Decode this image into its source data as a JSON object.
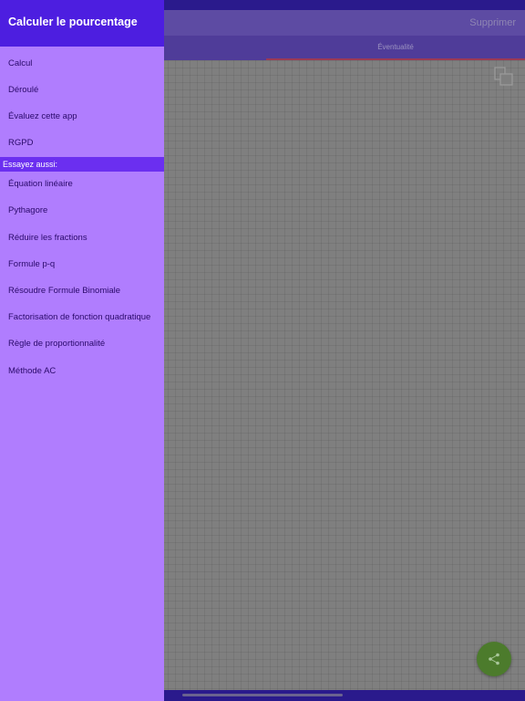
{
  "app": {
    "delete_label": "Supprimer",
    "tab_label": "Éventualité"
  },
  "drawer": {
    "title": "Calculer le pourcentage",
    "items": [
      {
        "label": "Calcul"
      },
      {
        "label": "Déroulé"
      },
      {
        "label": "Évaluez cette app"
      },
      {
        "label": "RGPD"
      }
    ],
    "section_label": "Essayez aussi:",
    "related": [
      {
        "label": "Équation linéaire"
      },
      {
        "label": "Pythagore"
      },
      {
        "label": "Réduire les fractions"
      },
      {
        "label": "Formule p-q"
      },
      {
        "label": "Résoudre Formule Binomiale"
      },
      {
        "label": "Factorisation de fonction quadratique"
      },
      {
        "label": "Règle de proportionnalité"
      },
      {
        "label": "Méthode AC"
      }
    ]
  },
  "icons": {
    "copy": "copy-icon",
    "share": "share-icon"
  },
  "colors": {
    "drawer_header": "#4d1ee0",
    "drawer_background": "#b07dfe",
    "section_header": "#6b2ff0",
    "share_button": "#4c7b2c"
  }
}
